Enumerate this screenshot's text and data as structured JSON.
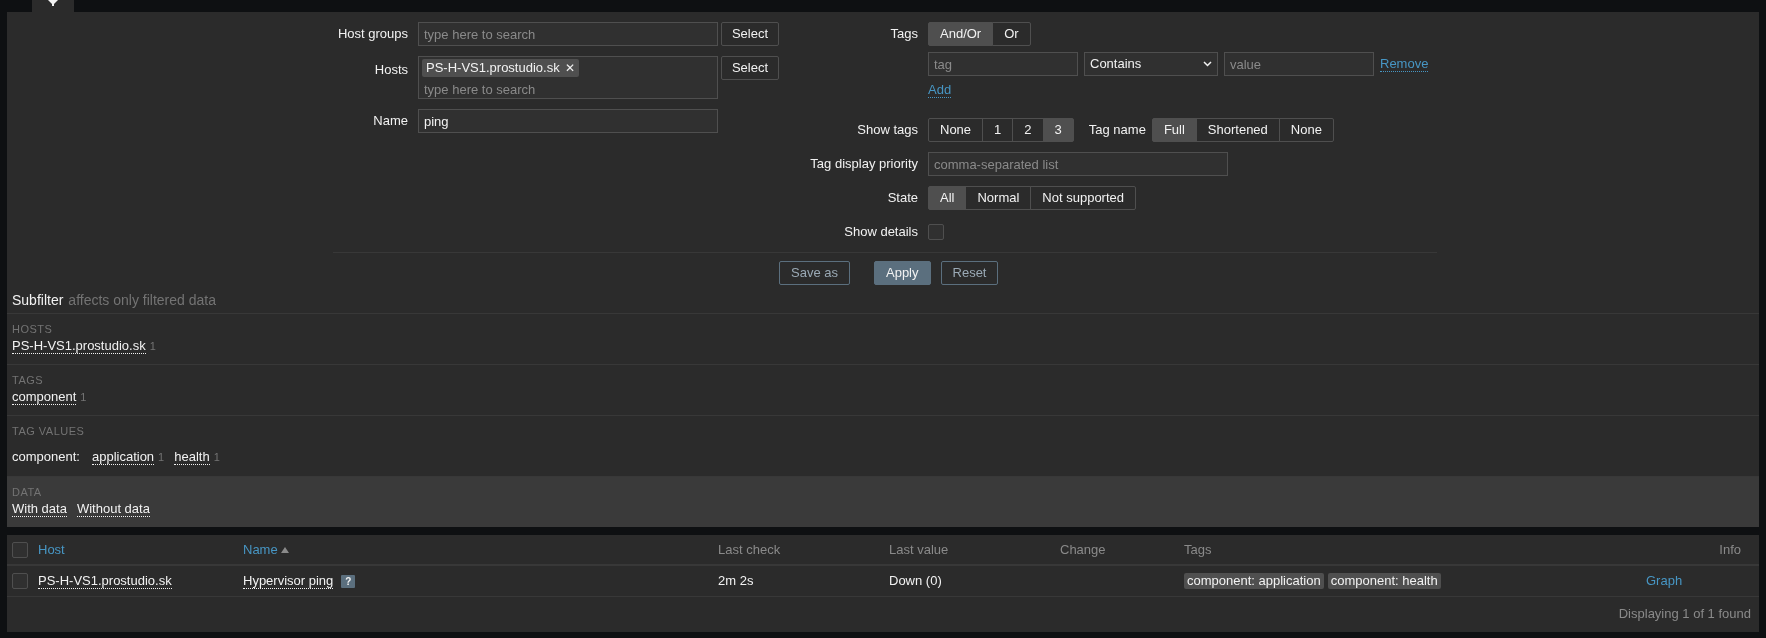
{
  "filter": {
    "host_groups": {
      "label": "Host groups",
      "placeholder": "type here to search",
      "button": "Select"
    },
    "hosts": {
      "label": "Hosts",
      "chips": [
        {
          "text": "PS-H-VS1.prostudio.sk",
          "remove": "✕"
        }
      ],
      "placeholder": "type here to search",
      "button": "Select"
    },
    "name": {
      "label": "Name",
      "value": "ping"
    },
    "tags": {
      "label": "Tags",
      "operators": [
        {
          "label": "And/Or",
          "selected": true
        },
        {
          "label": "Or",
          "selected": false
        }
      ],
      "rows": [
        {
          "tag_placeholder": "tag",
          "operator": "Contains",
          "value_placeholder": "value",
          "remove": "Remove"
        }
      ],
      "add": "Add"
    },
    "show_tags": {
      "label": "Show tags",
      "options": [
        {
          "label": "None",
          "selected": false
        },
        {
          "label": "1",
          "selected": false
        },
        {
          "label": "2",
          "selected": false
        },
        {
          "label": "3",
          "selected": true
        }
      ]
    },
    "tag_name": {
      "label": "Tag name",
      "options": [
        {
          "label": "Full",
          "selected": true
        },
        {
          "label": "Shortened",
          "selected": false
        },
        {
          "label": "None",
          "selected": false
        }
      ]
    },
    "tag_display_priority": {
      "label": "Tag display priority",
      "placeholder": "comma-separated list"
    },
    "state": {
      "label": "State",
      "options": [
        {
          "label": "All",
          "selected": true
        },
        {
          "label": "Normal",
          "selected": false
        },
        {
          "label": "Not supported",
          "selected": false
        }
      ]
    },
    "show_details": {
      "label": "Show details",
      "checked": false
    },
    "buttons": [
      {
        "label": "Save as",
        "kind": "outline"
      },
      {
        "label": "Apply",
        "kind": "primary"
      },
      {
        "label": "Reset",
        "kind": "outline"
      }
    ]
  },
  "subfilter": {
    "title": "Subfilter",
    "hint": "affects only filtered data",
    "sections": [
      {
        "heading": "HOSTS",
        "highlighted": false,
        "groups": [
          {
            "items": [
              {
                "label": "PS-H-VS1.prostudio.sk",
                "count": "1"
              }
            ]
          }
        ]
      },
      {
        "heading": "TAGS",
        "highlighted": false,
        "groups": [
          {
            "items": [
              {
                "label": "component",
                "count": "1"
              }
            ]
          }
        ]
      },
      {
        "heading": "TAG VALUES",
        "highlighted": false,
        "groups": [
          {
            "name": "component:",
            "items": [
              {
                "label": "application",
                "count": "1"
              },
              {
                "label": "health",
                "count": "1"
              }
            ]
          }
        ]
      },
      {
        "heading": "DATA",
        "highlighted": true,
        "groups": [
          {
            "items": [
              {
                "label": "With data"
              },
              {
                "label": "Without data"
              }
            ]
          }
        ]
      }
    ]
  },
  "table": {
    "select_all": false,
    "columns": [
      {
        "label": "Host",
        "sortable": true,
        "sorted": false
      },
      {
        "label": "Name",
        "sortable": true,
        "sorted": true
      },
      {
        "label": "Last check",
        "sortable": false,
        "sorted": false
      },
      {
        "label": "Last value",
        "sortable": false,
        "sorted": false
      },
      {
        "label": "Change",
        "sortable": false,
        "sorted": false
      },
      {
        "label": "Tags",
        "sortable": false,
        "sorted": false
      },
      {
        "label": "Info",
        "sortable": false,
        "sorted": false
      }
    ],
    "rows": [
      {
        "checked": false,
        "host": "PS-H-VS1.prostudio.sk",
        "name": "Hypervisor ping",
        "help": "?",
        "last_check": "2m 2s",
        "last_value": "Down (0)",
        "tags": [
          "component: application",
          "component: health"
        ],
        "info": "Graph"
      }
    ],
    "footer": "Displaying 1 of 1 found"
  }
}
